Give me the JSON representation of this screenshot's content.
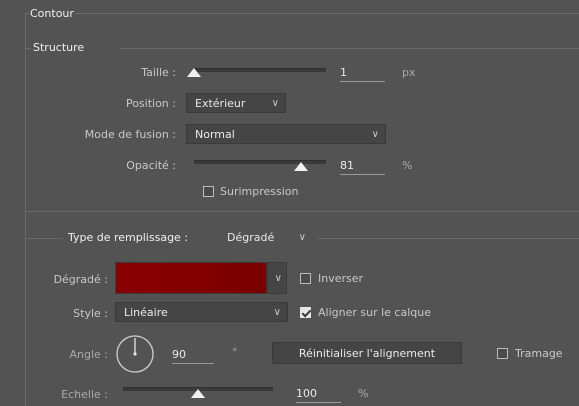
{
  "contour": {
    "title": "Contour",
    "structure": {
      "title": "Structure",
      "taille": {
        "label": "Taille :",
        "value": "1",
        "unit": "px",
        "level": 0.0
      },
      "position": {
        "label": "Position :",
        "selected": "Extérieur"
      },
      "mode_fusion": {
        "label": "Mode de fusion :",
        "selected": "Normal"
      },
      "opacite": {
        "label": "Opacité :",
        "value": "81",
        "unit": "%",
        "level": 0.81
      },
      "surimpression": {
        "label": "Surimpression",
        "checked": false
      }
    },
    "remplissage": {
      "label": "Type de remplissage :",
      "selected": "Dégradé",
      "degrade": {
        "label": "Dégradé :",
        "color_left": "#8a0000",
        "color_right": "#7a0000"
      },
      "inverser": {
        "label": "Inverser",
        "checked": false
      },
      "style": {
        "label": "Style :",
        "selected": "Linéaire"
      },
      "aligner": {
        "label": "Aligner sur le calque",
        "checked": true
      },
      "angle": {
        "label": "Angle :",
        "value": "90",
        "unit": "°"
      },
      "reset_button": "Réinitialiser l'alignement",
      "tramage": {
        "label": "Tramage",
        "checked": false
      },
      "echelle": {
        "label": "Echelle :",
        "value": "100",
        "unit": "%",
        "level": 0.5
      }
    }
  },
  "colors": {
    "panel_bg": "#535353",
    "field_bg": "#454545",
    "text": "#d6d6d6"
  }
}
